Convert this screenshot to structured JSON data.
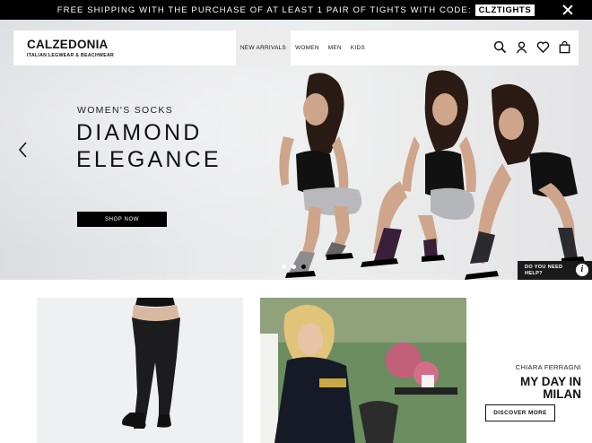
{
  "promo": {
    "message": "FREE SHIPPING WITH THE PURCHASE OF AT LEAST 1 PAIR OF TIGHTS WITH CODE:",
    "code": "CLZTIGHTS",
    "close_icon": "close-icon"
  },
  "header": {
    "logo_name": "CALZEDONIA",
    "logo_tagline": "ITALIAN LEGWEAR & BEACHWEAR",
    "nav": [
      "NEW ARRIVALS",
      "WOMEN",
      "MEN",
      "KIDS"
    ],
    "active_nav": "NEW ARRIVALS",
    "icons": [
      "search-icon",
      "account-icon",
      "heart-icon",
      "bag-icon"
    ]
  },
  "hero": {
    "eyebrow": "WOMEN'S SOCKS",
    "headline_line1": "DIAMOND",
    "headline_line2": "ELEGANCE",
    "cta": "SHOP NOW",
    "slides_total": 3,
    "active_slide": 3
  },
  "help": {
    "line1": "DO YOU NEED",
    "line2": "HELP?",
    "icon": "info-icon"
  },
  "feature": {
    "eyebrow": "CHIARA FERRAGNI",
    "title_line1": "MY DAY IN",
    "title_line2": "MILAN",
    "cta": "DISCOVER MORE"
  },
  "colors": {
    "promo_bg": "#000000",
    "button_bg": "#000000",
    "nav_active_bg": "#ececec"
  }
}
